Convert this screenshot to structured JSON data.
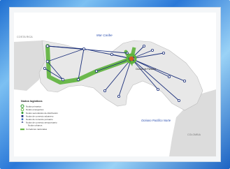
{
  "map": {
    "sea_north": "Mar Caribe",
    "sea_south": "Océano Pacífico Norte",
    "country_west": "COSTA RICA",
    "country_east": "COLOMBIA",
    "capital": "Ciudad de Panamá",
    "legend": {
      "title": "Nodos logísticos",
      "items": [
        "Nodos primarios",
        "Nodos emergentes",
        "Nodos secundarios de distribución",
        "Nodos de comercio aduanero",
        "Nodos de comercio portuario",
        "Nodos de comercio aeroportuario",
        "Nodos urbanos",
        "Corredores nacionales"
      ]
    },
    "colors": {
      "land": "#d9d9d9",
      "land_panama": "#e6e6e6",
      "corridor": "#5db33b",
      "route": "#1b2f7a",
      "node": "#2e9a2e",
      "hub": "#d25a1c"
    }
  }
}
